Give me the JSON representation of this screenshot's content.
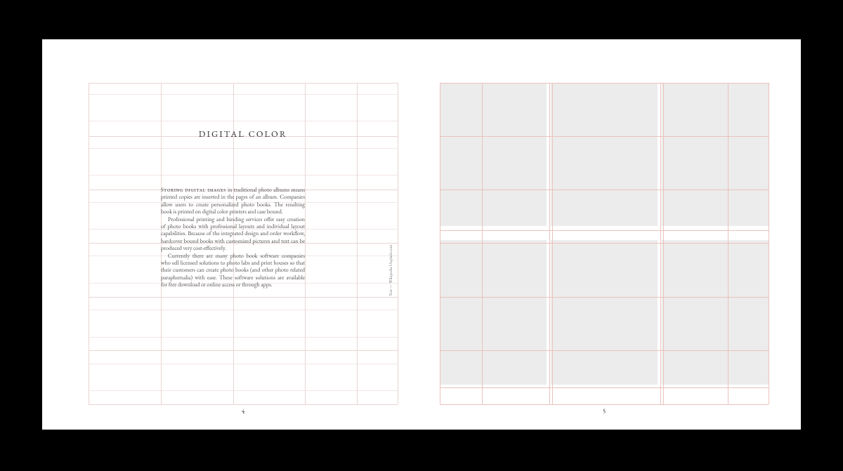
{
  "left": {
    "title": "DIGITAL COLOR",
    "paragraphs": [
      "Storing digital images in traditional photo albums means printed copies are inserted in the pages of an album. Companies allow users to create personalized photo books. The resulting book is printed on digital color printers and case bound.",
      "Professional printing and binding services offer easy creation of photo books with professional layouts and individual layout capabilities. Because of the integrated design and order workflow, hardcover bound books with customized pictures and text can be produced very cost-effectively.",
      "Currently there are many photo book software companies who sell licensed solutions to photo labs and print houses so that their customers can create photo books (and other photo related paraphernalia) with ease. These software solutions are available for free download or online access or through apps."
    ],
    "lead_smallcaps": "Storing digital images",
    "page_number": "4",
    "credit": "Text — Wikipedia       Unplash.com"
  },
  "right": {
    "page_number": "5"
  }
}
